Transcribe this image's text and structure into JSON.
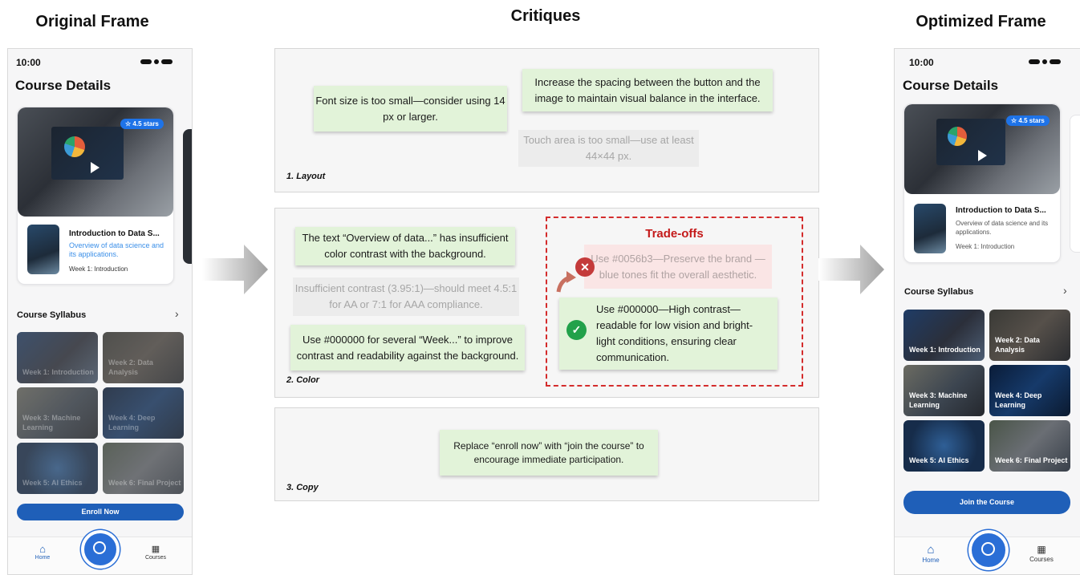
{
  "headings": {
    "original": "Original Frame",
    "critiques": "Critiques",
    "optimized": "Optimized Frame"
  },
  "original": {
    "time": "10:00",
    "title": "Course Details",
    "stars": "4.5 stars",
    "course_title": "Introduction to Data S...",
    "course_desc": "Overview of data science and its applications.",
    "course_week": "Week 1: Introduction",
    "syllabus_title": "Course Syllabus",
    "tiles": [
      "Week 1: Introduction",
      "Week 2: Data Analysis",
      "Week 3: Machine Learning",
      "Week 4: Deep Learning",
      "Week 5: AI Ethics",
      "Week 6: Final Project"
    ],
    "cta": "Enroll Now",
    "nav_home": "Home",
    "nav_courses": "Courses"
  },
  "optimized": {
    "time": "10:00",
    "title": "Course Details",
    "stars": "4.5 stars",
    "course_title": "Introduction to Data S...",
    "course_desc": "Overview of data science and its applications.",
    "course_week": "Week 1: Introduction",
    "syllabus_title": "Course Syllabus",
    "tiles": [
      "Week 1: Introduction",
      "Week 2: Data Analysis",
      "Week 3: Machine Learning",
      "Week 4: Deep Learning",
      "Week 5: AI Ethics",
      "Week 6: Final Project"
    ],
    "cta": "Join the Course",
    "nav_home": "Home",
    "nav_courses": "Courses"
  },
  "critiques": {
    "layout": {
      "label": "1. Layout",
      "font_size": "Font size is too small—consider using 14 px or larger.",
      "spacing": "Increase the spacing between the button and the image to maintain visual balance in the interface.",
      "touch": "Touch area is too small—use at least 44×44 px."
    },
    "color": {
      "label": "2. Color",
      "contrast_text": "The text “Overview of data...” has insufficient color contrast with the background.",
      "contrast_ratio": "Insufficient contrast (3.95:1)—should meet 4.5:1 for AA or 7:1 for AAA compliance.",
      "week_color": "Use #000000 for several “Week...” to improve contrast and readability against the background.",
      "tradeoffs_title": "Trade-offs",
      "rejected": "Use #0056b3—Preserve the brand —blue tones fit the overall aesthetic.",
      "accepted": "Use #000000—High contrast—readable for low vision and bright-light conditions, ensuring clear communication."
    },
    "copy": {
      "label": "3. Copy",
      "cta_copy": "Replace “enroll now” with “join the course” to encourage immediate participation."
    }
  },
  "colors": {
    "brand_blue": "#1f5fb8",
    "accent_blue": "#1e73e8",
    "note_green": "#e2f3d9",
    "tradeoff_red": "#d42c2c",
    "reject_red": "#c43a3a",
    "accept_green": "#22a14a"
  }
}
